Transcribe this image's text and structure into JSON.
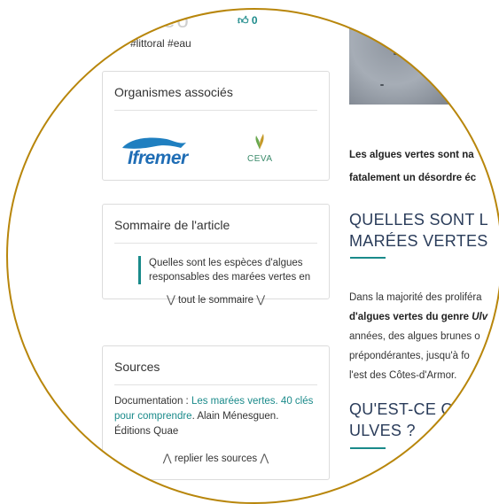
{
  "header": {
    "faint_text": "Ulleo",
    "like_count": "0",
    "tags": "#littoral #eau"
  },
  "organisms_card": {
    "title": "Organismes associés",
    "logos": [
      {
        "name": "ifremer-logo",
        "text": "Ifremer"
      },
      {
        "name": "ceva-logo",
        "text": "CEVA"
      }
    ]
  },
  "summary_card": {
    "title": "Sommaire de l'article",
    "item": "Quelles sont les espèces d'algues responsables des marées vertes en",
    "more_label": "tout le sommaire"
  },
  "sources_card": {
    "title": "Sources",
    "doc_prefix": "Documentation : ",
    "doc_link": "Les marées vertes. 40 clés pour comprendre",
    "doc_suffix": ". Alain Ménesguen. Éditions Quae",
    "less_label": "replier les sources"
  },
  "article": {
    "intro_line1": "Les algues vertes sont na",
    "intro_line2": "fatalement un désordre éc",
    "heading1_line1": "QUELLES SONT L",
    "heading1_line2": "MARÉES VERTES",
    "para_line1": "Dans la majorité des proliféra",
    "para_line2_bold": "d'algues vertes du genre ",
    "para_line2_italic": "Ulv",
    "para_line3": "années, des algues brunes o",
    "para_line4": "prépondérantes, jusqu'à fo",
    "para_line5": "l'est des Côtes-d'Armor.",
    "heading2_line1": "QU'EST-CE Q",
    "heading2_line2": "ULVES ?"
  },
  "colors": {
    "accent": "#1a8a8a",
    "ring": "#b8860b",
    "heading": "#2a3c5a"
  }
}
